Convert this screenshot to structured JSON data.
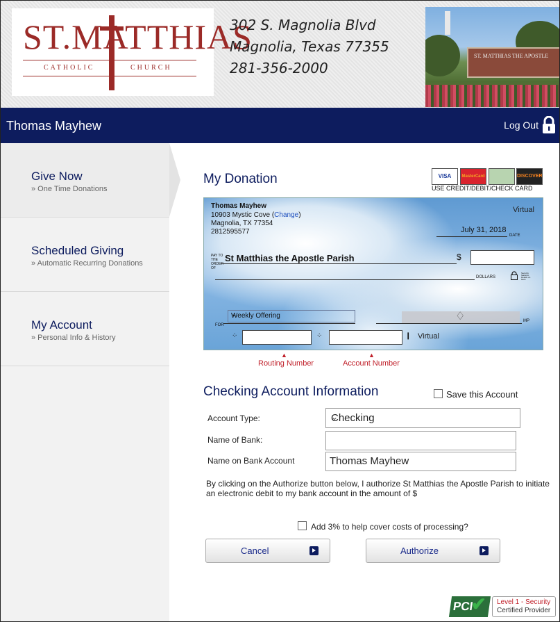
{
  "header": {
    "logo_main": "ST.MATTHIAS",
    "logo_sub_left": "CATHOLIC",
    "logo_sub_right": "CHURCH",
    "address_line1": "302 S. Magnolia Blvd",
    "address_line2": "Magnolia,  Texas  77355",
    "phone": "281-356-2000",
    "photo_sign_text": "ST. MATTHIAS THE APOSTLE"
  },
  "topbar": {
    "user_name": "Thomas Mayhew",
    "logout_label": "Log Out",
    "logout_icon": "lock-icon"
  },
  "sidebar": {
    "items": [
      {
        "title": "Give Now",
        "subtitle": "» One Time Donations"
      },
      {
        "title": "Scheduled Giving",
        "subtitle": "» Automatic Recurring Donations"
      },
      {
        "title": "My Account",
        "subtitle": "» Personal Info & History"
      }
    ]
  },
  "donation": {
    "heading": "My Donation",
    "cards_caption": "USE CREDIT/DEBIT/CHECK CARD",
    "card_labels": [
      "VISA",
      "MasterCard",
      "",
      "DISCOVER"
    ]
  },
  "check": {
    "payer_name": "Thomas Mayhew",
    "address_line1": "10903 Mystic Cove (",
    "change_link": "Change",
    "address_close": ")",
    "address_line2": "Magnolia, TX 77354",
    "phone": "2812595577",
    "virtual_label": "Virtual",
    "date": "July 31, 2018",
    "date_label": "DATE",
    "pay_to_label": "PAY TO THE ORDER OF",
    "payee": "St Matthias the Apostle Parish",
    "dollar_sign": "$",
    "dollars_label": "DOLLARS",
    "security_text": "Security features. Details on back.",
    "for_label": "FOR",
    "memo_selected": "Weekly Offering",
    "mp_label": "MP",
    "micr_virtual": "Virtual",
    "routing_label": "Routing Number",
    "account_label": "Account Number"
  },
  "checking_info": {
    "heading": "Checking Account Information",
    "save_label": "Save this Account",
    "account_type_label": "Account Type:",
    "account_type_value": "Checking",
    "bank_name_label": "Name of Bank:",
    "bank_name_value": "",
    "name_on_account_label": "Name on Bank Account",
    "name_on_account_value": "Thomas Mayhew"
  },
  "authorization": {
    "text": "By clicking on the Authorize button below, I authorize St Matthias the Apostle Parish to initiate an electronic debit to my bank account in the amount of $",
    "fee_label": "Add 3% to help cover costs of processing?",
    "cancel_label": "Cancel",
    "authorize_label": "Authorize"
  },
  "pci": {
    "logo_text": "PCI",
    "line1": "Level 1 - Security",
    "line2": "Certified Provider"
  },
  "colors": {
    "navy": "#0d1c5e",
    "brand_red": "#9b2a27",
    "alert_red": "#c0202a"
  }
}
